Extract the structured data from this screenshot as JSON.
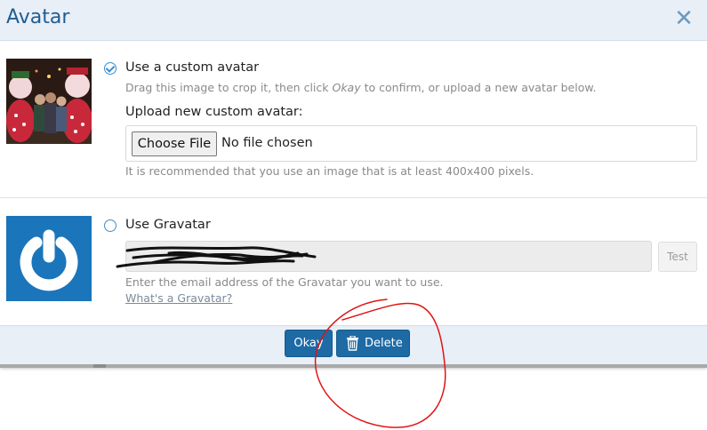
{
  "dialog": {
    "title": "Avatar",
    "close_icon": "close-icon",
    "accent_color": "#1d6aa5"
  },
  "custom": {
    "label": "Use a custom avatar",
    "hint_before": "Drag this image to crop it, then click ",
    "hint_em": "Okay",
    "hint_after": " to confirm, or upload a new avatar below.",
    "upload_label": "Upload new custom avatar:",
    "choose_label": "Choose File",
    "no_file": "No file chosen",
    "recommend": "It is recommended that you use an image that is at least 400x400 pixels.",
    "selected": true
  },
  "gravatar": {
    "label": "Use Gravatar",
    "test_label": "Test",
    "hint": "Enter the email address of the Gravatar you want to use.",
    "link": "What's a Gravatar?",
    "selected": false
  },
  "footer": {
    "okay_label": "Okay",
    "delete_label": "Delete",
    "delete_icon": "trash-icon"
  }
}
